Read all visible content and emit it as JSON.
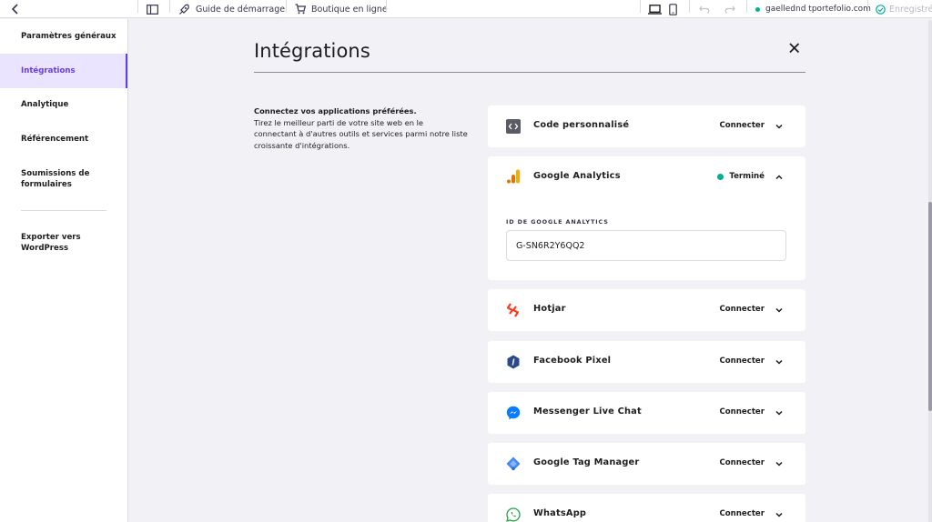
{
  "topbar": {
    "guide_label": "Guide de démarrage",
    "shop_label": "Boutique en ligne",
    "domain": "gaellednd tportefolio.com",
    "saved_label": "Enregistré"
  },
  "sidebar": {
    "items": [
      {
        "label": "Paramètres généraux"
      },
      {
        "label": "Intégrations"
      },
      {
        "label": "Analytique"
      },
      {
        "label": "Référencement"
      },
      {
        "label": "Soumissions de formulaires"
      },
      {
        "label": "Exporter vers WordPress"
      }
    ],
    "active_index": 1
  },
  "page": {
    "title": "Intégrations",
    "intro_heading": "Connectez vos applications préférées.",
    "intro_body": "Tirez le meilleur parti de votre site web en le connectant à d'autres outils et services parmi notre liste croissante d'intégrations."
  },
  "integrations": [
    {
      "name": "Code personnalisé",
      "action": "Connecter",
      "icon": "code-icon"
    },
    {
      "name": "Google Analytics",
      "action": "Terminé",
      "icon": "google-analytics-icon",
      "expanded": true,
      "field_label": "ID DE GOOGLE ANALYTICS",
      "field_value": "G-SN6R2Y6QQ2"
    },
    {
      "name": "Hotjar",
      "action": "Connecter",
      "icon": "hotjar-icon"
    },
    {
      "name": "Facebook Pixel",
      "action": "Connecter",
      "icon": "facebook-pixel-icon"
    },
    {
      "name": "Messenger Live Chat",
      "action": "Connecter",
      "icon": "messenger-icon"
    },
    {
      "name": "Google Tag Manager",
      "action": "Connecter",
      "icon": "google-tag-manager-icon"
    },
    {
      "name": "WhatsApp",
      "action": "Connecter",
      "icon": "whatsapp-icon"
    }
  ],
  "colors": {
    "accent": "#673de6",
    "active_bg": "#ebe4ff",
    "success": "#00b090"
  }
}
